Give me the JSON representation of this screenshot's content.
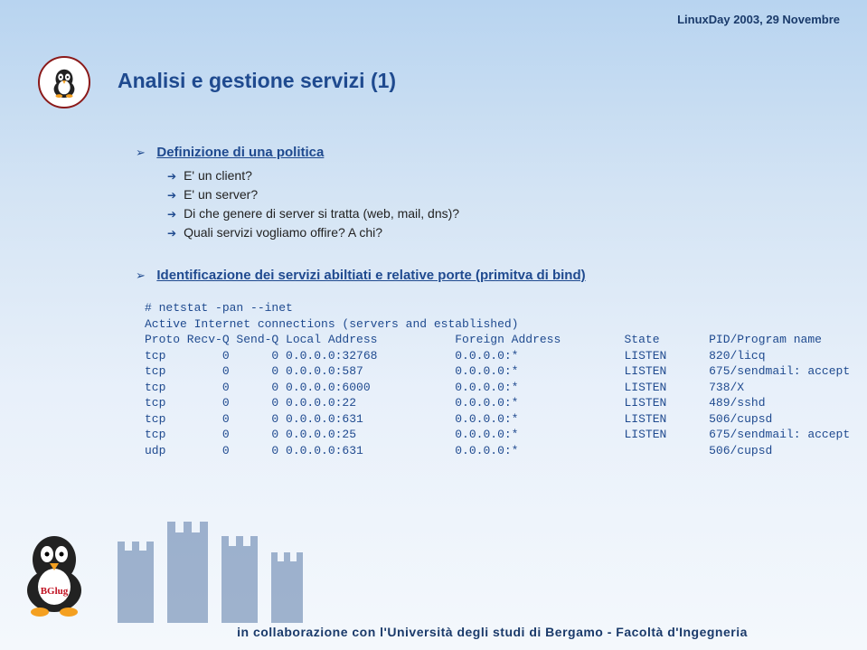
{
  "header": "LinuxDay 2003, 29 Novembre",
  "title": "Analisi e gestione servizi (1)",
  "section1": {
    "heading": "Definizione di una politica",
    "items": [
      "E' un client?",
      "E' un server?",
      "Di che genere di server si tratta (web, mail, dns)?",
      "Quali servizi vogliamo offire? A chi?"
    ]
  },
  "section2": {
    "heading": "Identificazione dei servizi abiltiati e relative porte (primitva di bind)"
  },
  "netstat": {
    "cmd": "# netstat -pan --inet",
    "line1": "Active Internet connections (servers and established)",
    "header": "Proto Recv-Q Send-Q Local Address           Foreign Address         State       PID/Program name",
    "rows": [
      "tcp        0      0 0.0.0.0:32768           0.0.0.0:*               LISTEN      820/licq",
      "tcp        0      0 0.0.0.0:587             0.0.0.0:*               LISTEN      675/sendmail: accept",
      "tcp        0      0 0.0.0.0:6000            0.0.0.0:*               LISTEN      738/X",
      "tcp        0      0 0.0.0.0:22              0.0.0.0:*               LISTEN      489/sshd",
      "tcp        0      0 0.0.0.0:631             0.0.0.0:*               LISTEN      506/cupsd",
      "tcp        0      0 0.0.0.0:25              0.0.0.0:*               LISTEN      675/sendmail: accept",
      "udp        0      0 0.0.0.0:631             0.0.0.0:*                           506/cupsd"
    ]
  },
  "footer": "in collaborazione con l'Università degli studi di Bergamo - Facoltà d'Ingegneria"
}
